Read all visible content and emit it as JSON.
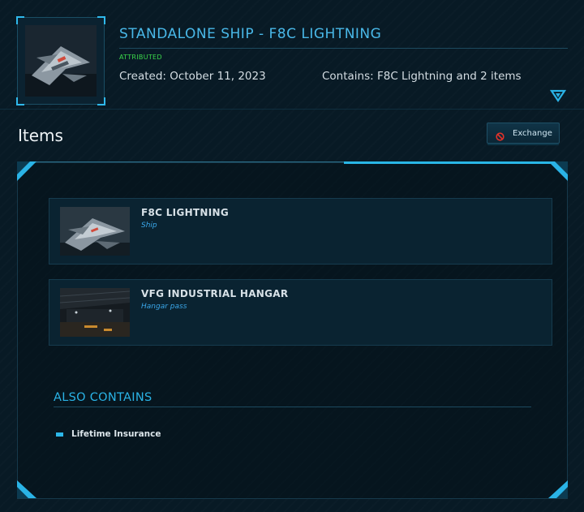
{
  "pledge": {
    "title": "STANDALONE SHIP - F8C LIGHTNING",
    "status": "ATTRIBUTED",
    "created": "Created: October 11, 2023",
    "contains": "Contains: F8C Lightning and 2 items"
  },
  "items_section": {
    "heading": "Items",
    "exchange_label": "Exchange",
    "items": [
      {
        "name": "F8C LIGHTNING",
        "type": "Ship"
      },
      {
        "name": "VFG INDUSTRIAL HANGAR",
        "type": "Hangar pass"
      }
    ]
  },
  "also_contains": {
    "heading": "ALSO CONTAINS",
    "items": [
      "Lifetime Insurance"
    ]
  },
  "colors": {
    "accent": "#2ab3e6",
    "status_green": "#3bd84b",
    "background": "#081a25"
  },
  "icons": [
    "ship-thumbnail",
    "expand-triangle-icon",
    "exchange-prohibited-icon",
    "bullet-icon"
  ]
}
